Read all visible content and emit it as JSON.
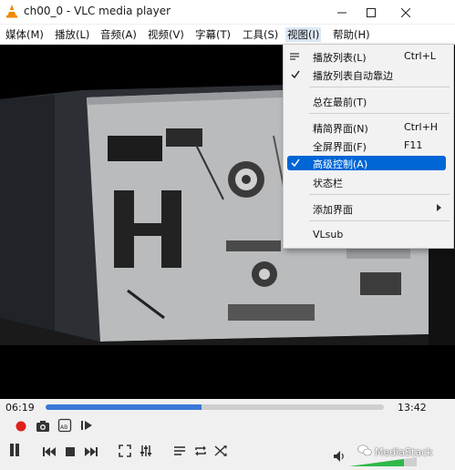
{
  "window": {
    "title": "ch00_0 - VLC media player"
  },
  "menubar": {
    "items": [
      "媒体(M)",
      "播放(L)",
      "音频(A)",
      "视频(V)",
      "字幕(T)",
      "工具(S)",
      "视图(I)",
      "帮助(H)"
    ],
    "active_index": 6
  },
  "view_menu": {
    "items": [
      {
        "label": "播放列表(L)",
        "shortcut": "Ctrl+L",
        "icon": "playlist-icon"
      },
      {
        "label": "播放列表自动靠边",
        "checked": true
      },
      {
        "label": "总在最前(T)"
      },
      {
        "label": "精简界面(N)",
        "shortcut": "Ctrl+H"
      },
      {
        "label": "全屏界面(F)",
        "shortcut": "F11"
      },
      {
        "label": "高级控制(A)",
        "checked": true,
        "highlighted": true
      },
      {
        "label": "状态栏"
      },
      {
        "label": "添加界面",
        "submenu": true
      },
      {
        "label": "VLsub"
      }
    ]
  },
  "playback": {
    "elapsed": "06:19",
    "total": "13:42",
    "progress": 0.46
  },
  "watermark": "MediaStack",
  "colors": {
    "accent": "#0066d6",
    "seek_fill": "#3a78d8",
    "volume": "#2fb84a",
    "record": "#e0201a"
  }
}
